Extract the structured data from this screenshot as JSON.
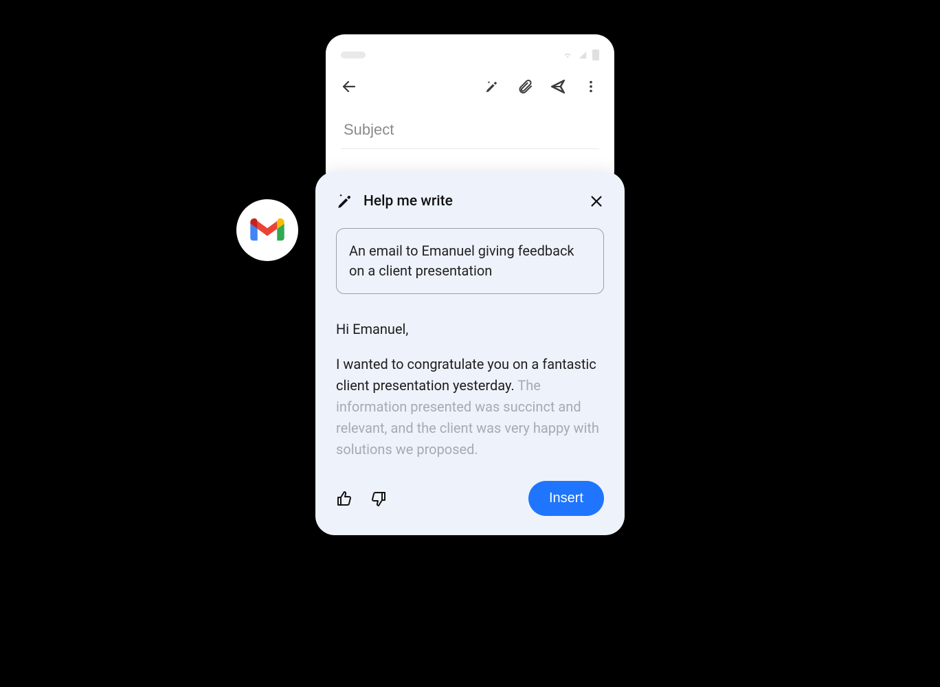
{
  "compose": {
    "subject_placeholder": "Subject"
  },
  "panel": {
    "title": "Help me write",
    "prompt": "An email to Emanuel giving feedback on a client presentation",
    "draft": {
      "greeting": "Hi Emanuel,",
      "body_strong": "I wanted to congratulate you on a fantastic client presentation yesterday.",
      "body_fade": "The information presented was succinct and relevant, and the client was very happy with solutions we proposed."
    },
    "insert_label": "Insert"
  },
  "icons": {
    "back": "back-arrow",
    "magic_pen": "magic-pen",
    "attachment": "attachment",
    "send": "send",
    "more": "more-vertical",
    "close": "close",
    "thumbs_up": "thumbs-up",
    "thumbs_down": "thumbs-down",
    "gmail": "gmail-logo"
  }
}
